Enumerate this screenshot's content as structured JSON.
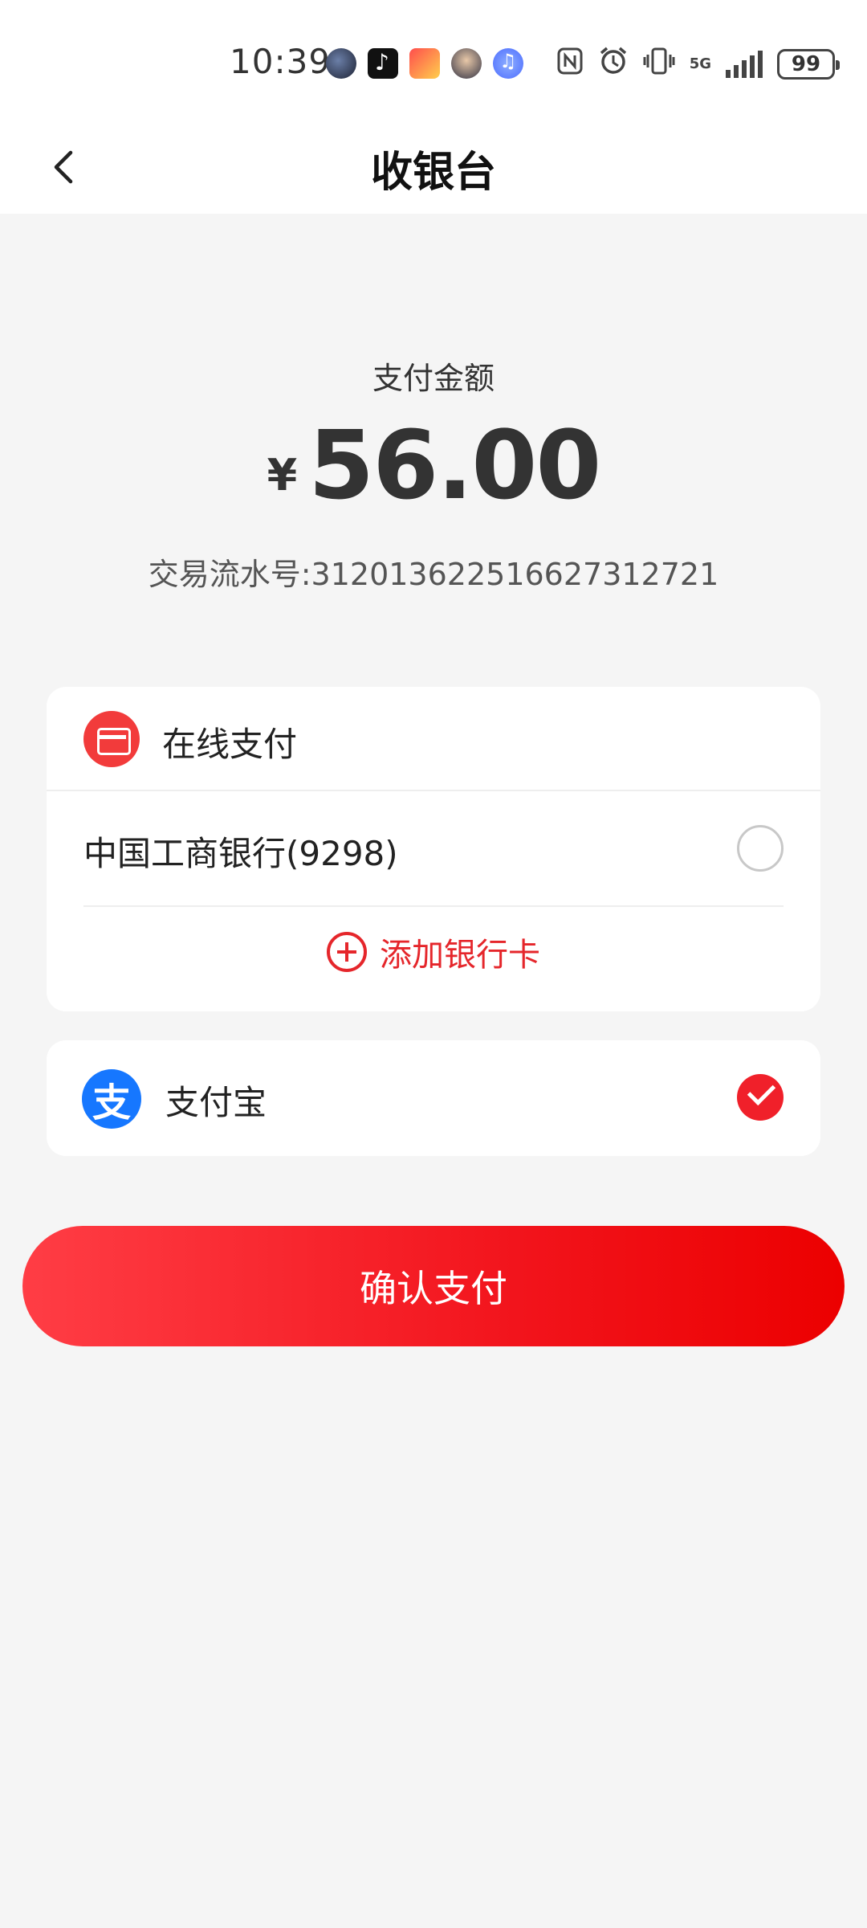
{
  "status_bar": {
    "time": "10:39",
    "network": "5G",
    "battery": "99"
  },
  "nav": {
    "title": "收银台"
  },
  "payment": {
    "amount_label": "支付金额",
    "currency_symbol": "¥",
    "amount": "56.00",
    "transaction_label": "交易流水号:",
    "transaction_id": "3120136225166273127 21"
  },
  "online_payment": {
    "title": "在线支付",
    "bank_account": "中国工商银行(9298)",
    "bank_selected": false,
    "add_card_label": "添加银行卡"
  },
  "alipay": {
    "label": "支付宝",
    "selected": true,
    "icon_glyph": "支"
  },
  "confirm_button": {
    "label": "确认支付"
  },
  "colors": {
    "accent": "#f0202a",
    "alipay_blue": "#1677ff",
    "background": "#f5f5f5"
  }
}
